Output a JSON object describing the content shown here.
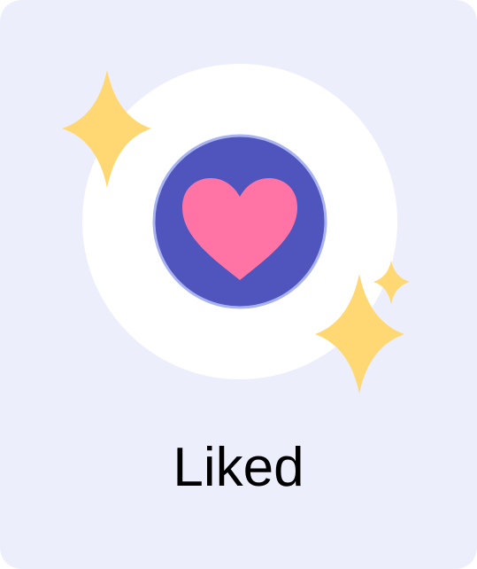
{
  "card": {
    "label": "Liked"
  },
  "icons": {
    "center": "heart-icon",
    "decorations": [
      "sparkle-icon",
      "sparkle-icon",
      "sparkle-icon"
    ]
  },
  "colors": {
    "card_background": "#ECEEFC",
    "halo": "#FFFFFF",
    "badge_fill": "#4F55BC",
    "badge_ring": "#A9B3F2",
    "heart": "#FF73A5",
    "sparkle": "#FFD874",
    "label_text": "#000000"
  }
}
